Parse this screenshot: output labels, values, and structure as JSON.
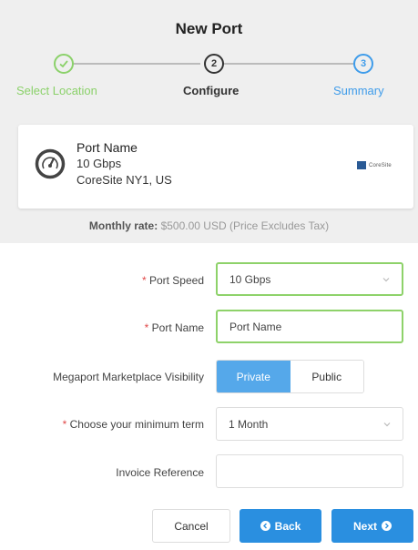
{
  "header": {
    "title": "New Port",
    "steps": [
      {
        "number": "1",
        "label": "Select Location",
        "state": "complete"
      },
      {
        "number": "2",
        "label": "Configure",
        "state": "current"
      },
      {
        "number": "3",
        "label": "Summary",
        "state": "upcoming"
      }
    ]
  },
  "colors": {
    "complete": "#8bd16a",
    "current": "#333333",
    "upcoming": "#3f9cea",
    "primary_button": "#2a8fe0",
    "toggle_active": "#55a8ea",
    "valid_border": "#8ed26a",
    "required": "#e04848"
  },
  "port_card": {
    "icon": "gauge-icon",
    "name": "Port Name",
    "speed": "10 Gbps",
    "location": "CoreSite NY1, US",
    "provider_logo": "CoreSite"
  },
  "rate": {
    "label": "Monthly rate:",
    "value": "$500.00 USD (Price Excludes Tax)"
  },
  "form": {
    "required_marker": "*",
    "port_speed": {
      "label": "Port Speed",
      "value": "10 Gbps"
    },
    "port_name": {
      "label": "Port Name",
      "value": "Port Name"
    },
    "visibility": {
      "label": "Megaport Marketplace Visibility",
      "options": [
        "Private",
        "Public"
      ],
      "selected": "Private"
    },
    "term": {
      "label": "Choose your minimum term",
      "value": "1 Month"
    },
    "invoice": {
      "label": "Invoice Reference",
      "value": ""
    }
  },
  "buttons": {
    "cancel": "Cancel",
    "back": "Back",
    "next": "Next"
  }
}
